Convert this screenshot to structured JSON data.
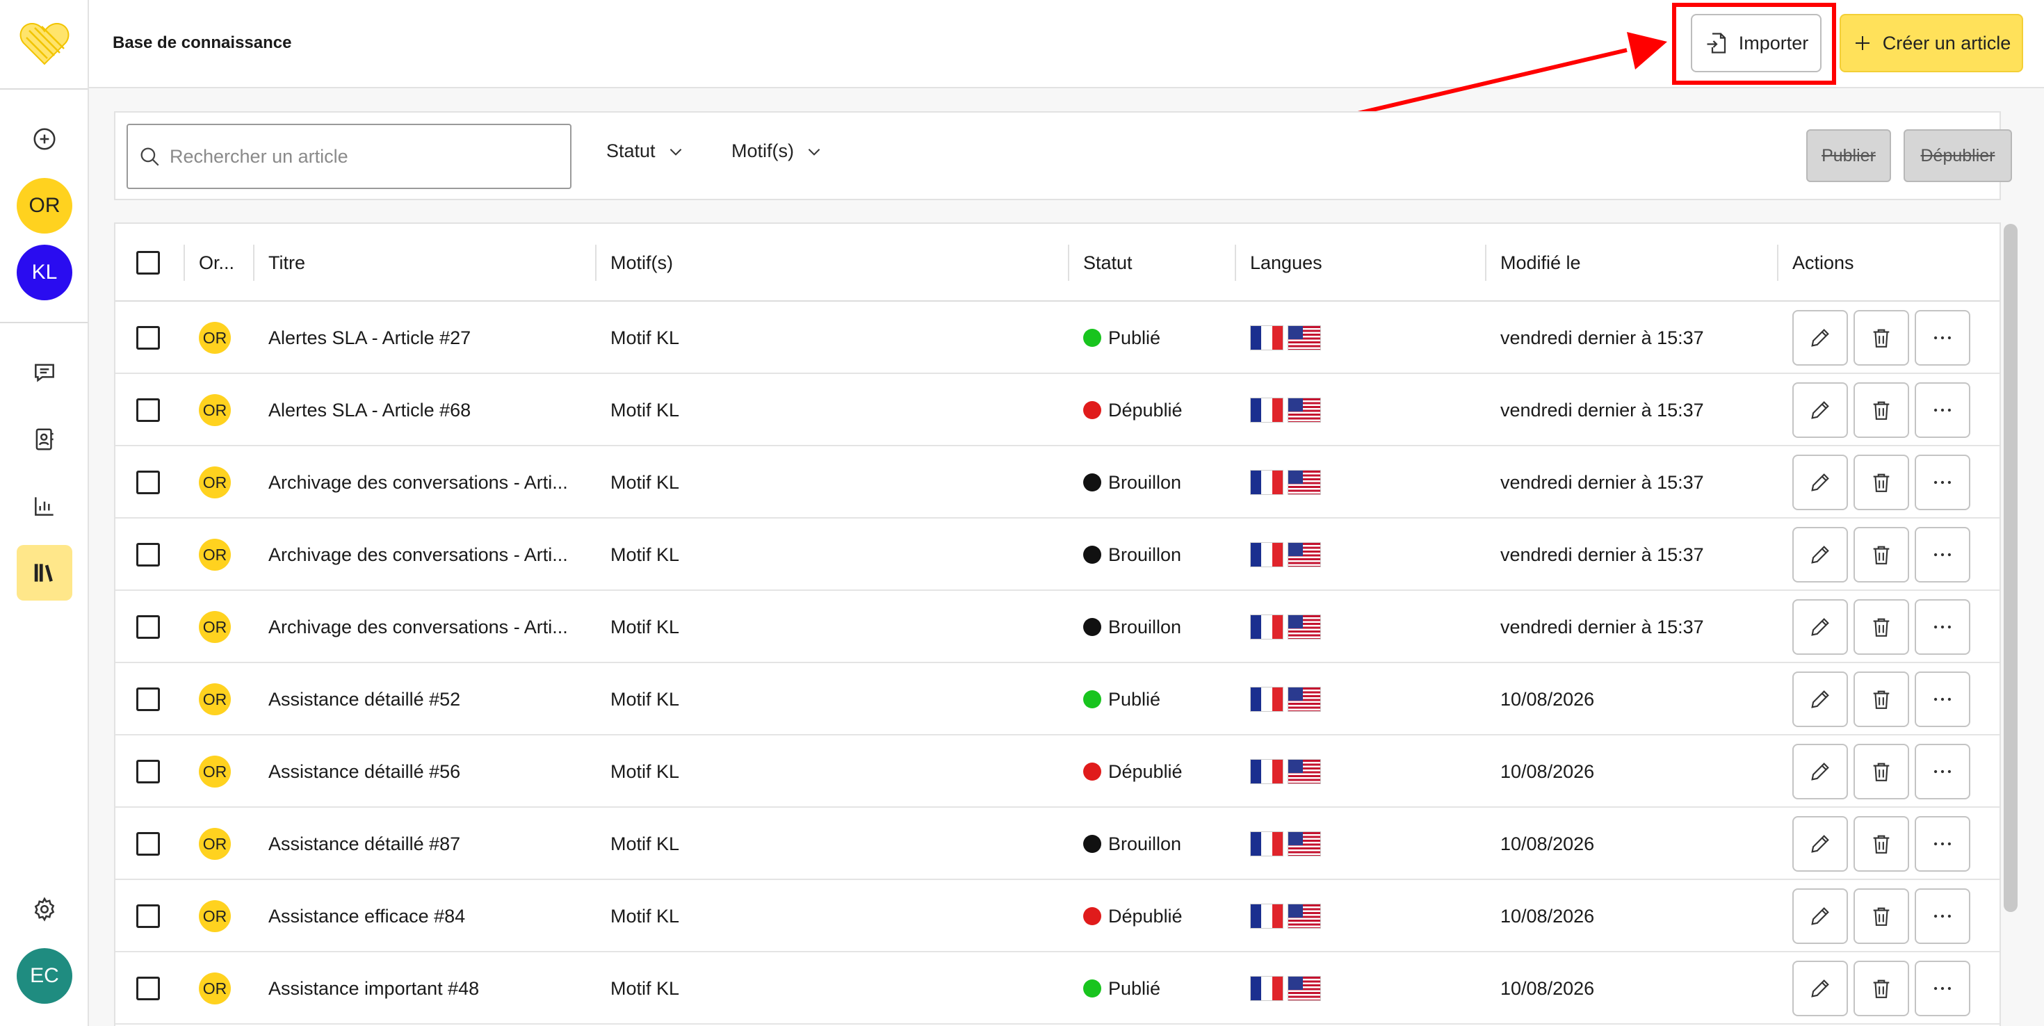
{
  "header": {
    "title": "Base de connaissance",
    "import_label": "Importer",
    "create_label": "Créer un article"
  },
  "sidebar": {
    "avatars": [
      {
        "initials": "OR",
        "color": "#ffd21f",
        "text_color": "#222222"
      },
      {
        "initials": "KL",
        "color": "#2a0cf0",
        "text_color": "#ffffff"
      }
    ],
    "user_avatar": {
      "initials": "EC",
      "color": "#1f8c80",
      "text_color": "#ffffff"
    },
    "icons": [
      "plus-circle-icon",
      "chat-icon",
      "contacts-icon",
      "stats-icon",
      "library-icon",
      "gear-icon"
    ]
  },
  "toolbar": {
    "search_placeholder": "Rechercher un article",
    "filter_status": "Statut",
    "filter_reasons": "Motif(s)",
    "publish_label": "Publier",
    "unpublish_label": "Dépublier"
  },
  "table": {
    "columns": {
      "org": "Or...",
      "title": "Titre",
      "reasons": "Motif(s)",
      "status": "Statut",
      "languages": "Langues",
      "modified": "Modifié le",
      "actions": "Actions"
    },
    "status_colors": {
      "Publié": "#18c41e",
      "Dépublié": "#e01b1b",
      "Brouillon": "#111111"
    },
    "rows": [
      {
        "org": "OR",
        "title": "Alertes SLA - Article #27",
        "reason": "Motif KL",
        "status": "Publié",
        "modified": "vendredi dernier à 15:37"
      },
      {
        "org": "OR",
        "title": "Alertes SLA - Article #68",
        "reason": "Motif KL",
        "status": "Dépublié",
        "modified": "vendredi dernier à 15:37"
      },
      {
        "org": "OR",
        "title": "Archivage des conversations - Arti...",
        "reason": "Motif KL",
        "status": "Brouillon",
        "modified": "vendredi dernier à 15:37"
      },
      {
        "org": "OR",
        "title": "Archivage des conversations - Arti...",
        "reason": "Motif KL",
        "status": "Brouillon",
        "modified": "vendredi dernier à 15:37"
      },
      {
        "org": "OR",
        "title": "Archivage des conversations - Arti...",
        "reason": "Motif KL",
        "status": "Brouillon",
        "modified": "vendredi dernier à 15:37"
      },
      {
        "org": "OR",
        "title": "Assistance détaillé #52",
        "reason": "Motif KL",
        "status": "Publié",
        "modified": "10/08/2026"
      },
      {
        "org": "OR",
        "title": "Assistance détaillé #56",
        "reason": "Motif KL",
        "status": "Dépublié",
        "modified": "10/08/2026"
      },
      {
        "org": "OR",
        "title": "Assistance détaillé #87",
        "reason": "Motif KL",
        "status": "Brouillon",
        "modified": "10/08/2026"
      },
      {
        "org": "OR",
        "title": "Assistance efficace #84",
        "reason": "Motif KL",
        "status": "Dépublié",
        "modified": "10/08/2026"
      },
      {
        "org": "OR",
        "title": "Assistance important #48",
        "reason": "Motif KL",
        "status": "Publié",
        "modified": "10/08/2026"
      }
    ]
  },
  "annotation": {
    "color": "#ff0000"
  }
}
